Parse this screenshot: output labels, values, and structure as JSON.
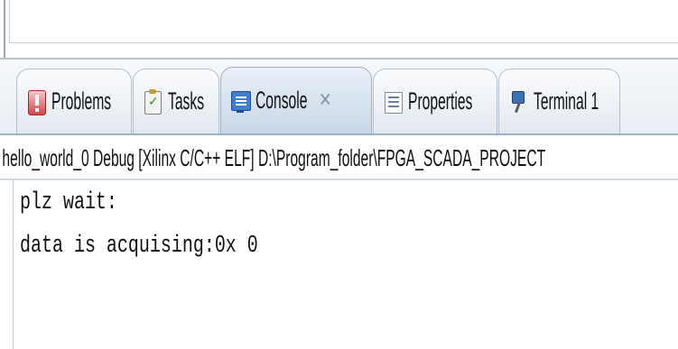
{
  "tabs": [
    {
      "label": "Problems",
      "icon": "problems-icon"
    },
    {
      "label": "Tasks",
      "icon": "tasks-icon"
    },
    {
      "label": "Console",
      "icon": "console-icon",
      "active": true
    },
    {
      "label": "Properties",
      "icon": "properties-icon"
    },
    {
      "label": "Terminal 1",
      "icon": "terminal-icon"
    }
  ],
  "console": {
    "launch_description": "hello_world_0 Debug [Xilinx C/C++ ELF] D:\\Program_folder\\FPGA_SCADA_PROJECT",
    "lines": [
      "plz wait:",
      "data is acquising:0x 0"
    ]
  },
  "colors": {
    "active_tab": "#c8d7e8",
    "tab_border": "#b4bfcd"
  }
}
